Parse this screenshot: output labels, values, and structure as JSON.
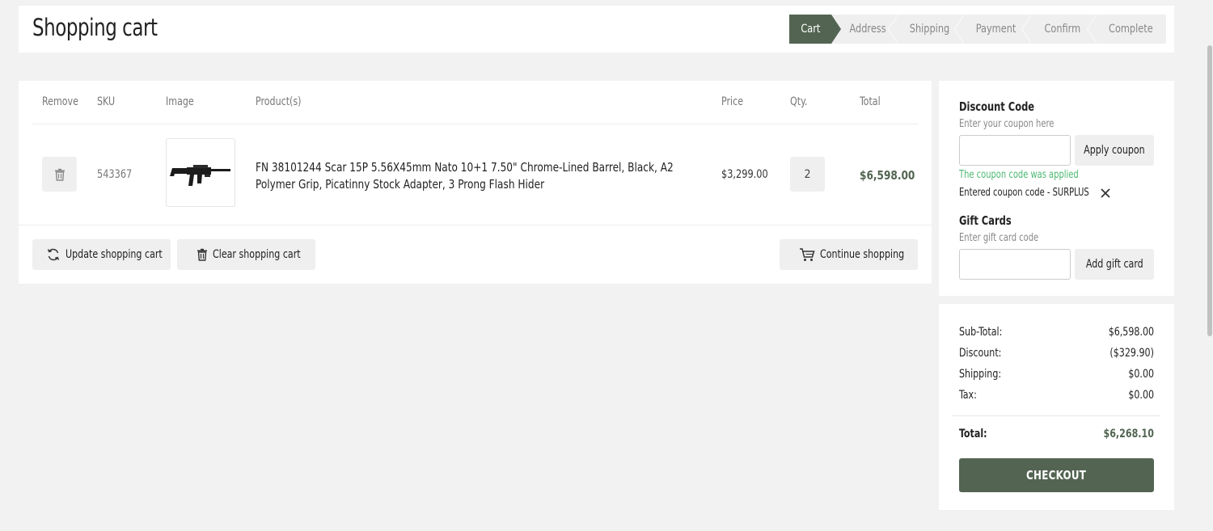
{
  "header": {
    "title": "Shopping cart",
    "steps": [
      "Cart",
      "Address",
      "Shipping",
      "Payment",
      "Confirm",
      "Complete"
    ],
    "active_step": "Cart"
  },
  "cart": {
    "columns": {
      "remove": "Remove",
      "sku": "SKU",
      "image": "Image",
      "product": "Product(s)",
      "price": "Price",
      "qty": "Qty.",
      "total": "Total"
    },
    "items": [
      {
        "sku": "543367",
        "name": "FN 38101244 Scar 15P 5.56X45mm Nato 10+1 7.50\" Chrome-Lined Barrel, Black, A2 Polymer Grip, Picatinny Stock Adapter, 3 Prong Flash Hider",
        "price": "$3,299.00",
        "qty": "2",
        "total": "$6,598.00",
        "image_icon": "rifle-image"
      }
    ],
    "buttons": {
      "update": "Update shopping cart",
      "clear": "Clear shopping cart",
      "continue": "Continue shopping"
    }
  },
  "discount": {
    "title": "Discount Code",
    "hint": "Enter your coupon here",
    "input_value": "",
    "apply_label": "Apply coupon",
    "applied_message": "The coupon code was applied",
    "entered_code": "Entered coupon code - SURPLUS"
  },
  "gift_cards": {
    "title": "Gift Cards",
    "hint": "Enter gift card code",
    "input_value": "",
    "add_label": "Add gift card"
  },
  "totals": {
    "subtotal_label": "Sub-Total:",
    "subtotal": "$6,598.00",
    "discount_label": "Discount:",
    "discount": "($329.90)",
    "shipping_label": "Shipping:",
    "shipping": "$0.00",
    "tax_label": "Tax:",
    "tax": "$0.00",
    "total_label": "Total:",
    "total": "$6,268.10",
    "checkout_label": "CHECKOUT"
  },
  "colors": {
    "accent": "#536552",
    "success": "#4cb872",
    "background": "#f2f2f2"
  }
}
